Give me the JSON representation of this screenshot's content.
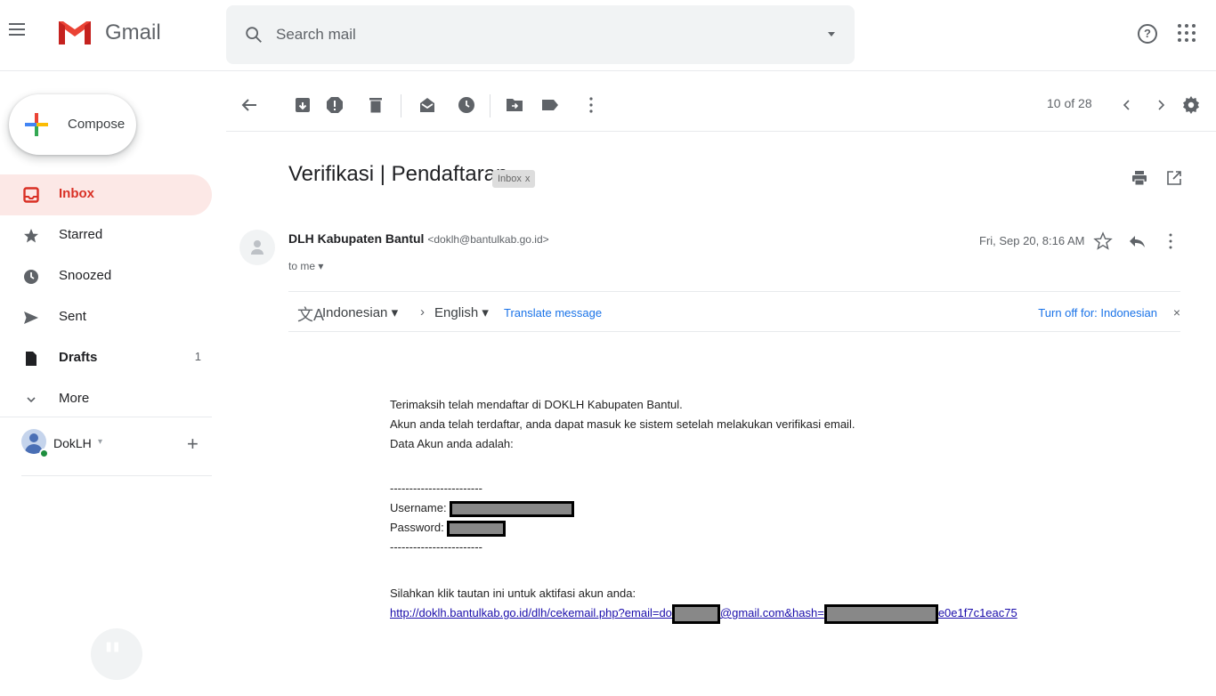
{
  "header": {
    "brand": "Gmail",
    "search_placeholder": "Search mail"
  },
  "sidebar": {
    "compose_label": "Compose",
    "items": [
      {
        "label": "Inbox",
        "count": ""
      },
      {
        "label": "Starred",
        "count": ""
      },
      {
        "label": "Snoozed",
        "count": ""
      },
      {
        "label": "Sent",
        "count": ""
      },
      {
        "label": "Drafts",
        "count": "1"
      },
      {
        "label": "More",
        "count": ""
      }
    ],
    "account_name": "DokLH"
  },
  "toolbar": {
    "pager": "10 of 28"
  },
  "message": {
    "subject": "Verifikasi | Pendaftaran",
    "label_chip": "Inbox",
    "sender_name": "DLH Kabupaten Bantul",
    "sender_email": "<doklh@bantulkab.go.id>",
    "to": "to me",
    "date": "Fri, Sep 20, 8:16 AM"
  },
  "translate": {
    "source_lang": "Indonesian",
    "target_lang": "English",
    "translate_link": "Translate message",
    "turn_off": "Turn off for: Indonesian"
  },
  "body": {
    "line1": "Terimaksih telah mendaftar di DOKLH Kabupaten Bantul.",
    "line2": "Akun anda telah terdaftar, anda dapat masuk ke sistem setelah melakukan verifikasi email.",
    "line3": "Data Akun anda adalah:",
    "separator": "------------------------",
    "username_label": "Username:",
    "password_label": "Password:",
    "instruction": "Silahkan klik tautan ini untuk aktifasi akun anda:",
    "link_part1": "http://doklh.bantulkab.go.id/dlh/cekemail.php?email=do",
    "link_part2": "@gmail.com&hash=",
    "link_part3": "e0e1f7c1eac75"
  },
  "colors": {
    "accent_red": "#d93025",
    "inbox_bg": "#fce8e6",
    "link_blue": "#1a73e8"
  }
}
